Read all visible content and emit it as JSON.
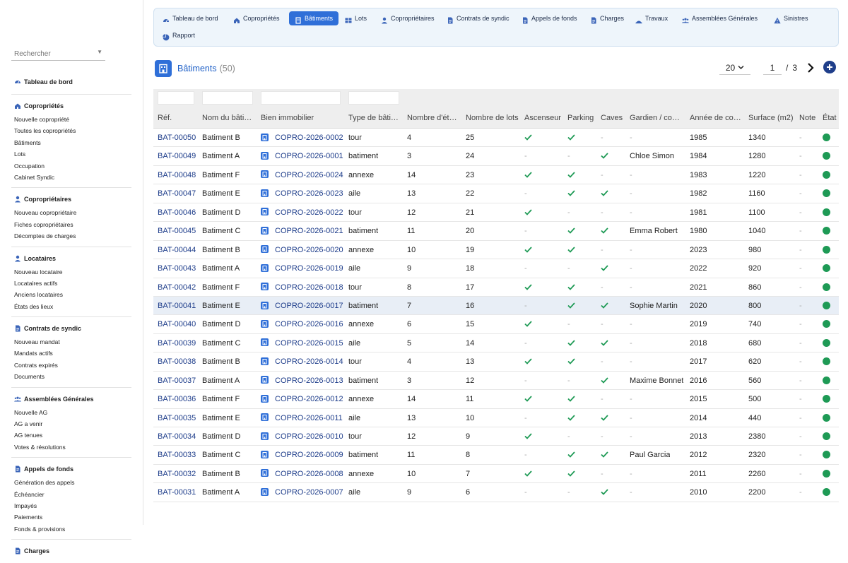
{
  "sidebar": {
    "search_placeholder": "Rechercher",
    "groups": [
      {
        "title": "Tableau de bord",
        "icon": "dashboard-icon",
        "items": []
      },
      {
        "title": "Copropriétés",
        "icon": "home-icon",
        "items": [
          "Nouvelle copropriété",
          "Toutes les copropriétés",
          "Bâtiments",
          "Lots",
          "Occupation",
          "Cabinet Syndic"
        ]
      },
      {
        "title": "Copropriétaires",
        "icon": "user-icon",
        "items": [
          "Nouveau copropriétaire",
          "Fiches copropriétaires",
          "Décomptes de charges"
        ]
      },
      {
        "title": "Locataires",
        "icon": "user-icon",
        "items": [
          "Nouveau locataire",
          "Locataires actifs",
          "Anciens locataires",
          "États des lieux"
        ]
      },
      {
        "title": "Contrats de syndic",
        "icon": "document-icon",
        "items": [
          "Nouveau mandat",
          "Mandats actifs",
          "Contrats expirés",
          "Documents"
        ]
      },
      {
        "title": "Assemblées Générales",
        "icon": "users-icon",
        "items": [
          "Nouvelle AG",
          "AG a venir",
          "AG tenues",
          "Votes & résolutions"
        ]
      },
      {
        "title": "Appels de fonds",
        "icon": "document-icon",
        "items": [
          "Génération des appels",
          "Échéancier",
          "Impayés",
          "Paiements",
          "Fonds & provisions"
        ]
      },
      {
        "title": "Charges",
        "icon": "document-icon",
        "items": []
      }
    ]
  },
  "topnav": {
    "tabs": [
      {
        "label": "Tableau de bord",
        "icon": "dashboard-icon",
        "active": false
      },
      {
        "label": "Copropriétés",
        "icon": "home-icon",
        "active": false
      },
      {
        "label": "Bâtiments",
        "icon": "building-icon",
        "active": true
      },
      {
        "label": "Lots",
        "icon": "grid-icon",
        "active": false
      },
      {
        "label": "Copropriétaires",
        "icon": "user-icon",
        "active": false
      },
      {
        "label": "Contrats de syndic",
        "icon": "document-icon",
        "active": false
      },
      {
        "label": "Appels de fonds",
        "icon": "document-icon",
        "active": false
      },
      {
        "label": "Charges",
        "icon": "document-icon",
        "active": false
      },
      {
        "label": "Travaux",
        "icon": "tools-icon",
        "active": false
      },
      {
        "label": "Assemblées Générales",
        "icon": "users-icon",
        "active": false
      },
      {
        "label": "Sinistres",
        "icon": "warning-icon",
        "active": false
      },
      {
        "label": "Rapport",
        "icon": "chart-icon",
        "active": false
      }
    ]
  },
  "page": {
    "title": "Bâtiments",
    "count": "(50)",
    "per_page": "20",
    "current_page": "1",
    "page_sep": "/",
    "total_pages": "3"
  },
  "table": {
    "columns": [
      "Réf.",
      "Nom du bâti…",
      "Bien immobilier",
      "Type de bâti…",
      "Nombre d'ét…",
      "Nombre de lots",
      "Ascenseur",
      "Parking",
      "Caves",
      "Gardien / co…",
      "Année de co…",
      "Surface (m2)",
      "Note",
      "État"
    ],
    "rows": [
      {
        "ref": "BAT-00050",
        "nom": "Batiment B",
        "bien": "COPRO-2026-0002",
        "type": "tour",
        "etages": "4",
        "lots": "25",
        "ascenseur": true,
        "parking": true,
        "caves": false,
        "gardien": "-",
        "annee": "1985",
        "surface": "1340",
        "note": "-"
      },
      {
        "ref": "BAT-00049",
        "nom": "Batiment A",
        "bien": "COPRO-2026-0001",
        "type": "batiment",
        "etages": "3",
        "lots": "24",
        "ascenseur": false,
        "parking": false,
        "caves": true,
        "gardien": "Chloe Simon",
        "annee": "1984",
        "surface": "1280",
        "note": "-"
      },
      {
        "ref": "BAT-00048",
        "nom": "Batiment F",
        "bien": "COPRO-2026-0024",
        "type": "annexe",
        "etages": "14",
        "lots": "23",
        "ascenseur": true,
        "parking": true,
        "caves": false,
        "gardien": "-",
        "annee": "1983",
        "surface": "1220",
        "note": "-"
      },
      {
        "ref": "BAT-00047",
        "nom": "Batiment E",
        "bien": "COPRO-2026-0023",
        "type": "aile",
        "etages": "13",
        "lots": "22",
        "ascenseur": false,
        "parking": true,
        "caves": true,
        "gardien": "-",
        "annee": "1982",
        "surface": "1160",
        "note": "-"
      },
      {
        "ref": "BAT-00046",
        "nom": "Batiment D",
        "bien": "COPRO-2026-0022",
        "type": "tour",
        "etages": "12",
        "lots": "21",
        "ascenseur": true,
        "parking": false,
        "caves": false,
        "gardien": "-",
        "annee": "1981",
        "surface": "1100",
        "note": "-"
      },
      {
        "ref": "BAT-00045",
        "nom": "Batiment C",
        "bien": "COPRO-2026-0021",
        "type": "batiment",
        "etages": "11",
        "lots": "20",
        "ascenseur": false,
        "parking": true,
        "caves": true,
        "gardien": "Emma Robert",
        "annee": "1980",
        "surface": "1040",
        "note": "-"
      },
      {
        "ref": "BAT-00044",
        "nom": "Batiment B",
        "bien": "COPRO-2026-0020",
        "type": "annexe",
        "etages": "10",
        "lots": "19",
        "ascenseur": true,
        "parking": true,
        "caves": false,
        "gardien": "-",
        "annee": "2023",
        "surface": "980",
        "note": "-"
      },
      {
        "ref": "BAT-00043",
        "nom": "Batiment A",
        "bien": "COPRO-2026-0019",
        "type": "aile",
        "etages": "9",
        "lots": "18",
        "ascenseur": false,
        "parking": false,
        "caves": true,
        "gardien": "-",
        "annee": "2022",
        "surface": "920",
        "note": "-"
      },
      {
        "ref": "BAT-00042",
        "nom": "Batiment F",
        "bien": "COPRO-2026-0018",
        "type": "tour",
        "etages": "8",
        "lots": "17",
        "ascenseur": true,
        "parking": true,
        "caves": false,
        "gardien": "-",
        "annee": "2021",
        "surface": "860",
        "note": "-"
      },
      {
        "ref": "BAT-00041",
        "nom": "Batiment E",
        "bien": "COPRO-2026-0017",
        "type": "batiment",
        "etages": "7",
        "lots": "16",
        "ascenseur": false,
        "parking": true,
        "caves": true,
        "gardien": "Sophie Martin",
        "annee": "2020",
        "surface": "800",
        "note": "-",
        "highlight": true
      },
      {
        "ref": "BAT-00040",
        "nom": "Batiment D",
        "bien": "COPRO-2026-0016",
        "type": "annexe",
        "etages": "6",
        "lots": "15",
        "ascenseur": true,
        "parking": false,
        "caves": false,
        "gardien": "-",
        "annee": "2019",
        "surface": "740",
        "note": "-"
      },
      {
        "ref": "BAT-00039",
        "nom": "Batiment C",
        "bien": "COPRO-2026-0015",
        "type": "aile",
        "etages": "5",
        "lots": "14",
        "ascenseur": false,
        "parking": true,
        "caves": true,
        "gardien": "-",
        "annee": "2018",
        "surface": "680",
        "note": "-"
      },
      {
        "ref": "BAT-00038",
        "nom": "Batiment B",
        "bien": "COPRO-2026-0014",
        "type": "tour",
        "etages": "4",
        "lots": "13",
        "ascenseur": true,
        "parking": true,
        "caves": false,
        "gardien": "-",
        "annee": "2017",
        "surface": "620",
        "note": "-"
      },
      {
        "ref": "BAT-00037",
        "nom": "Batiment A",
        "bien": "COPRO-2026-0013",
        "type": "batiment",
        "etages": "3",
        "lots": "12",
        "ascenseur": false,
        "parking": false,
        "caves": true,
        "gardien": "Maxime Bonnet",
        "annee": "2016",
        "surface": "560",
        "note": "-"
      },
      {
        "ref": "BAT-00036",
        "nom": "Batiment F",
        "bien": "COPRO-2026-0012",
        "type": "annexe",
        "etages": "14",
        "lots": "11",
        "ascenseur": true,
        "parking": true,
        "caves": false,
        "gardien": "-",
        "annee": "2015",
        "surface": "500",
        "note": "-"
      },
      {
        "ref": "BAT-00035",
        "nom": "Batiment E",
        "bien": "COPRO-2026-0011",
        "type": "aile",
        "etages": "13",
        "lots": "10",
        "ascenseur": false,
        "parking": true,
        "caves": true,
        "gardien": "-",
        "annee": "2014",
        "surface": "440",
        "note": "-"
      },
      {
        "ref": "BAT-00034",
        "nom": "Batiment D",
        "bien": "COPRO-2026-0010",
        "type": "tour",
        "etages": "12",
        "lots": "9",
        "ascenseur": true,
        "parking": false,
        "caves": false,
        "gardien": "-",
        "annee": "2013",
        "surface": "2380",
        "note": "-"
      },
      {
        "ref": "BAT-00033",
        "nom": "Batiment C",
        "bien": "COPRO-2026-0009",
        "type": "batiment",
        "etages": "11",
        "lots": "8",
        "ascenseur": false,
        "parking": true,
        "caves": true,
        "gardien": "Paul Garcia",
        "annee": "2012",
        "surface": "2320",
        "note": "-"
      },
      {
        "ref": "BAT-00032",
        "nom": "Batiment B",
        "bien": "COPRO-2026-0008",
        "type": "annexe",
        "etages": "10",
        "lots": "7",
        "ascenseur": true,
        "parking": true,
        "caves": false,
        "gardien": "-",
        "annee": "2011",
        "surface": "2260",
        "note": "-"
      },
      {
        "ref": "BAT-00031",
        "nom": "Batiment A",
        "bien": "COPRO-2026-0007",
        "type": "aile",
        "etages": "9",
        "lots": "6",
        "ascenseur": false,
        "parking": false,
        "caves": true,
        "gardien": "-",
        "annee": "2010",
        "surface": "2200",
        "note": "-"
      }
    ]
  },
  "colors": {
    "accent": "#2f6fd8",
    "link": "#1d3c8a",
    "check": "#1e9a55",
    "status_ok": "#1e9a55"
  }
}
